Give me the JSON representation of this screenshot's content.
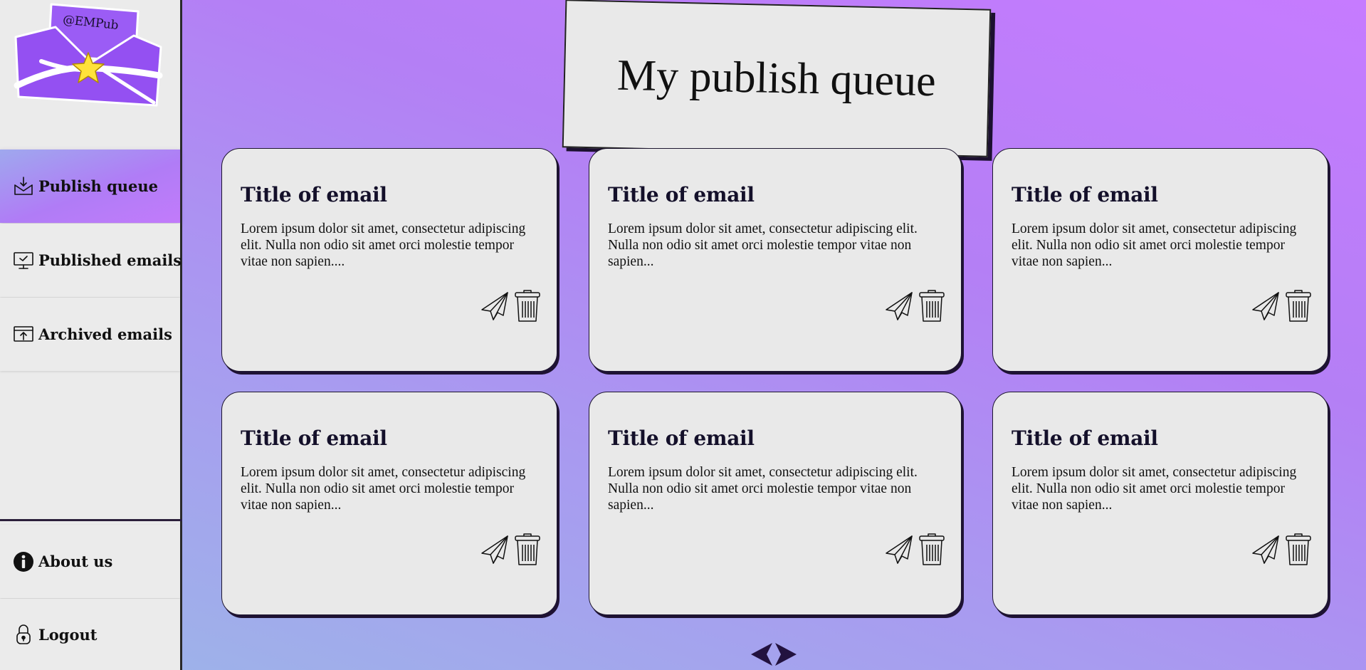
{
  "brand": {
    "logo_text": "@EMPub"
  },
  "sidebar": {
    "items": [
      {
        "label": "Publish queue",
        "icon": "inbox-download-icon",
        "active": true
      },
      {
        "label": "Published emails",
        "icon": "monitor-check-icon",
        "active": false
      },
      {
        "label": "Archived emails",
        "icon": "archive-upload-icon",
        "active": false
      }
    ],
    "bottom_items": [
      {
        "label": "About us",
        "icon": "info-icon"
      },
      {
        "label": "Logout",
        "icon": "lock-icon"
      }
    ]
  },
  "header": {
    "title": "My publish queue"
  },
  "cards": [
    {
      "title": "Title of email",
      "body": "Lorem ipsum dolor sit amet, consectetur adipiscing elit. Nulla non odio sit amet orci molestie tempor vitae non sapien...."
    },
    {
      "title": "Title of email",
      "body": "Lorem ipsum dolor sit amet, consectetur adipiscing elit. Nulla non odio sit amet orci molestie tempor vitae non sapien..."
    },
    {
      "title": "Title of email",
      "body": "Lorem ipsum dolor sit amet, consectetur adipiscing elit. Nulla non odio sit amet orci molestie tempor vitae non sapien..."
    },
    {
      "title": "Title of email",
      "body": "Lorem ipsum dolor sit amet, consectetur adipiscing elit. Nulla non odio sit amet orci molestie tempor vitae non sapien..."
    },
    {
      "title": "Title of email",
      "body": "Lorem ipsum dolor sit amet, consectetur adipiscing elit. Nulla non odio sit amet orci molestie tempor vitae non sapien..."
    },
    {
      "title": "Title of email",
      "body": "Lorem ipsum dolor sit amet, consectetur adipiscing elit. Nulla non odio sit amet orci molestie tempor vitae non sapien..."
    }
  ],
  "card_actions": {
    "send_icon": "paper-plane-icon",
    "delete_icon": "trash-icon"
  },
  "pagination": {
    "prev_icon": "chevron-left-icon",
    "next_icon": "chevron-right-icon"
  },
  "colors": {
    "background_top": "#c67bff",
    "background_bottom": "#9cb6e8",
    "card_bg": "#e9e9e9",
    "ink": "#14102a",
    "logo_purple": "#9b5cf5",
    "star": "#ffe23a"
  }
}
